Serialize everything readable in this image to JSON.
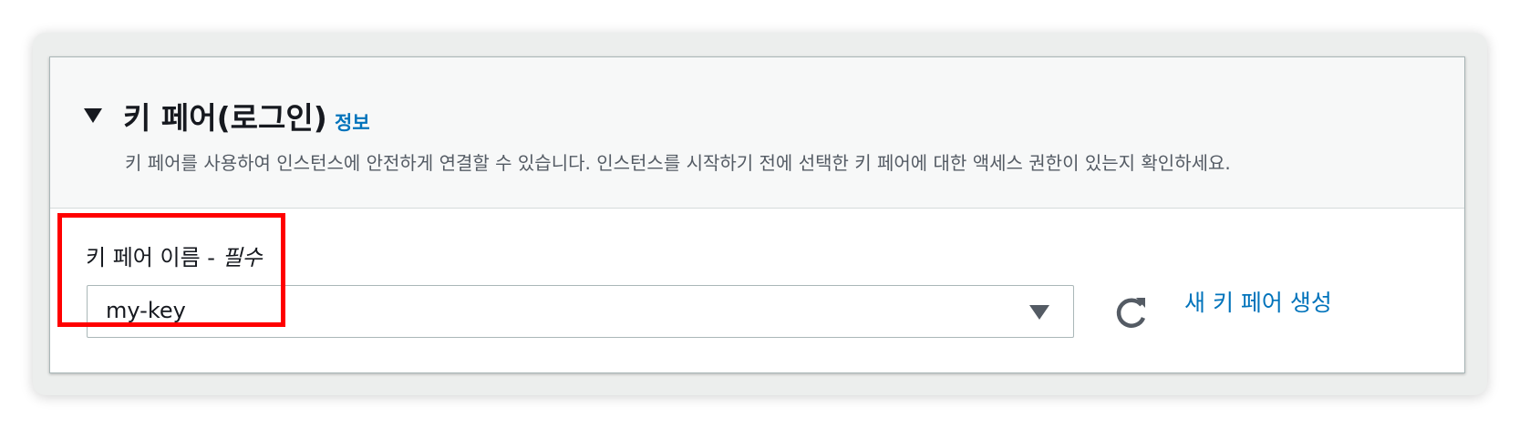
{
  "section": {
    "title": "키 페어(로그인)",
    "info_link": "정보",
    "description": "키 페어를 사용하여 인스턴스에 안전하게 연결할 수 있습니다. 인스턴스를 시작하기 전에 선택한 키 페어에 대한 액세스 권한이 있는지 확인하세요."
  },
  "key_pair_field": {
    "label": "키 페어 이름 - ",
    "required_label": "필수",
    "selected_value": "my-key"
  },
  "actions": {
    "refresh_icon": "refresh-icon",
    "create_link": "새 키 페어 생성"
  },
  "colors": {
    "link": "#0073bb",
    "highlight": "#ff0000",
    "header_background": "#f7f8f8"
  }
}
